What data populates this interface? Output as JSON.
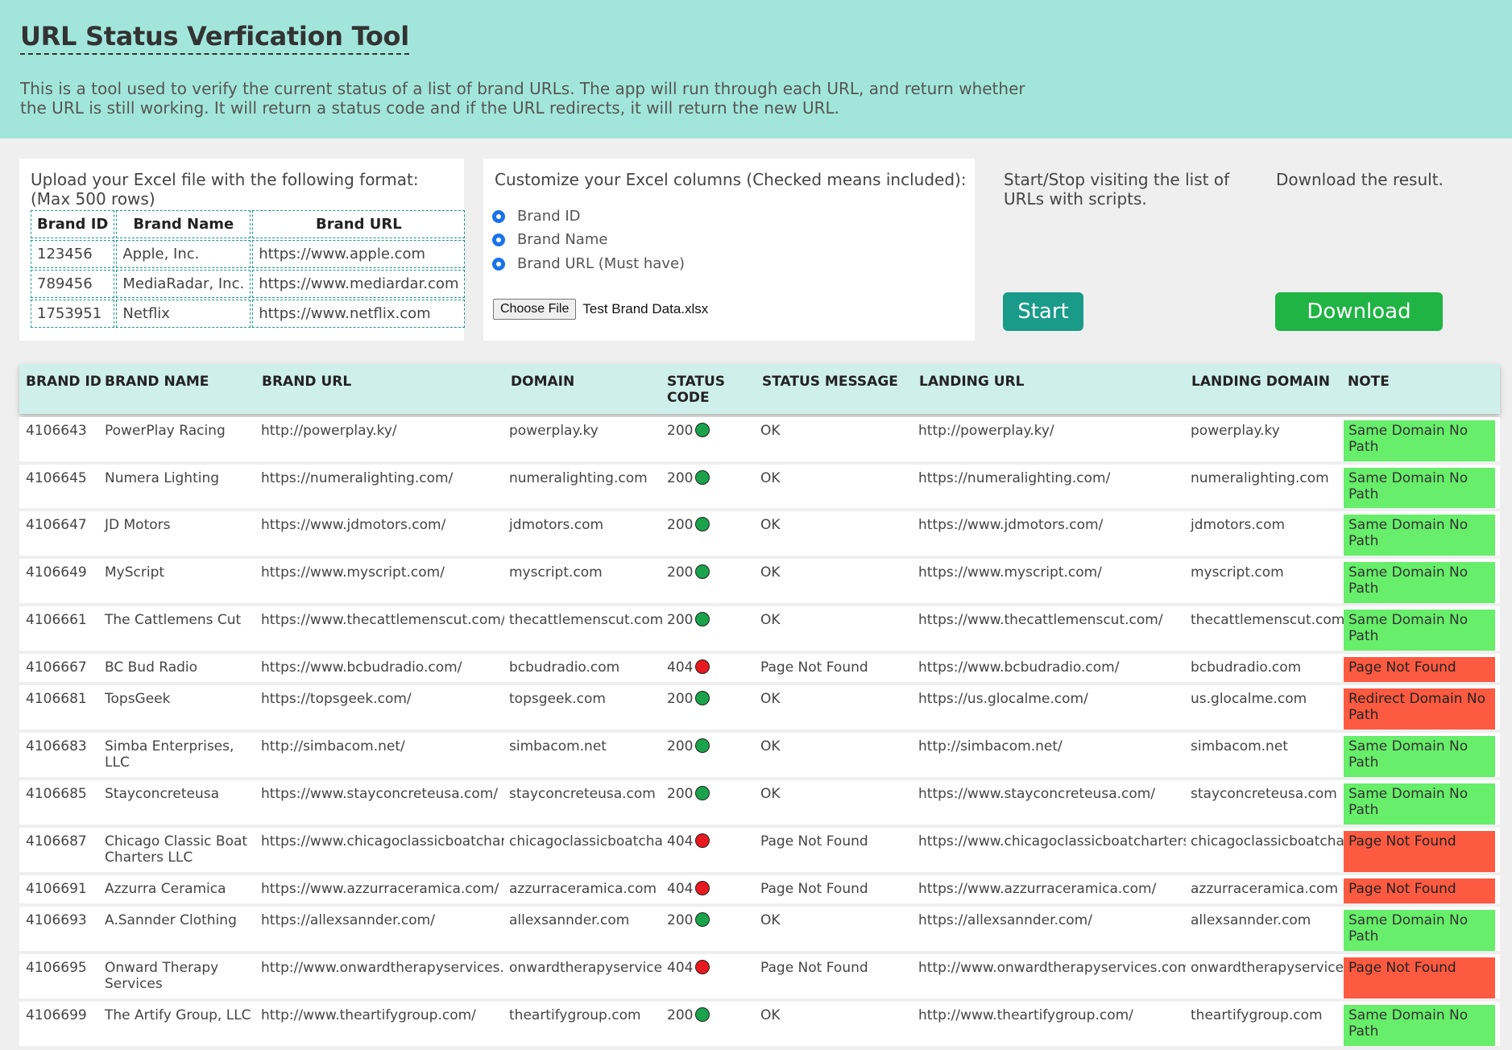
{
  "header": {
    "title": "URL Status Verfication Tool",
    "description": "This is a tool used to verify the current status of a list of brand URLs. The app will run through each URL, and return whether the URL is still working. It will return a status code and if the URL redirects, it will return the new URL."
  },
  "upload": {
    "instructions": "Upload your Excel file with the following format:",
    "max_rows": "(Max 500 rows)",
    "format_headers": [
      "Brand ID",
      "Brand Name",
      "Brand URL"
    ],
    "format_rows": [
      [
        "123456",
        "Apple, Inc.",
        "https://www.apple.com"
      ],
      [
        "789456",
        "MediaRadar, Inc.",
        "https://www.mediardar.com"
      ],
      [
        "1753951",
        "Netflix",
        "https://www.netflix.com"
      ]
    ]
  },
  "customize": {
    "label": "Customize your Excel columns (Checked means included):",
    "options": [
      "Brand ID",
      "Brand Name",
      "Brand URL (Must have)"
    ],
    "choose_file_label": "Choose File",
    "file_name": "Test Brand Data.xlsx"
  },
  "start_section": {
    "text": "Start/Stop visiting the list of URLs with scripts.",
    "button": "Start"
  },
  "download_section": {
    "text": "Download the result.",
    "button": "Download"
  },
  "results": {
    "headers": [
      "BRAND ID",
      "BRAND NAME",
      "BRAND URL",
      "DOMAIN",
      "STATUS CODE",
      "STATUS MESSAGE",
      "LANDING URL",
      "LANDING DOMAIN",
      "NOTE"
    ],
    "colors": {
      "ok": "#1aa34a",
      "error": "#e8191f",
      "note_ok": "#67ee6a",
      "note_error": "#fc5a41"
    },
    "rows": [
      {
        "id": "4106643",
        "name": "PowerPlay Racing",
        "url": "http://powerplay.ky/",
        "domain": "powerplay.ky",
        "code": "200",
        "msg": "OK",
        "landing": "http://powerplay.ky/",
        "ldomain": "powerplay.ky",
        "note": "Same Domain No Path"
      },
      {
        "id": "4106645",
        "name": "Numera Lighting",
        "url": "https://numeralighting.com/",
        "domain": "numeralighting.com",
        "code": "200",
        "msg": "OK",
        "landing": "https://numeralighting.com/",
        "ldomain": "numeralighting.com",
        "note": "Same Domain No Path"
      },
      {
        "id": "4106647",
        "name": "JD Motors",
        "url": "https://www.jdmotors.com/",
        "domain": "jdmotors.com",
        "code": "200",
        "msg": "OK",
        "landing": "https://www.jdmotors.com/",
        "ldomain": "jdmotors.com",
        "note": "Same Domain No Path"
      },
      {
        "id": "4106649",
        "name": "MyScript",
        "url": "https://www.myscript.com/",
        "domain": "myscript.com",
        "code": "200",
        "msg": "OK",
        "landing": "https://www.myscript.com/",
        "ldomain": "myscript.com",
        "note": "Same Domain No Path"
      },
      {
        "id": "4106661",
        "name": "The Cattlemens Cut",
        "url": "https://www.thecattlemenscut.com/",
        "domain": "thecattlemenscut.com",
        "code": "200",
        "msg": "OK",
        "landing": "https://www.thecattlemenscut.com/",
        "ldomain": "thecattlemenscut.com",
        "note": "Same Domain No Path"
      },
      {
        "id": "4106667",
        "name": "BC Bud Radio",
        "url": "https://www.bcbudradio.com/",
        "domain": "bcbudradio.com",
        "code": "404",
        "msg": "Page Not Found",
        "landing": "https://www.bcbudradio.com/",
        "ldomain": "bcbudradio.com",
        "note": "Page Not Found"
      },
      {
        "id": "4106681",
        "name": "TopsGeek",
        "url": "https://topsgeek.com/",
        "domain": "topsgeek.com",
        "code": "200",
        "msg": "OK",
        "landing": "https://us.glocalme.com/",
        "ldomain": "us.glocalme.com",
        "note": "Redirect Domain No Path"
      },
      {
        "id": "4106683",
        "name": "Simba Enterprises, LLC",
        "url": "http://simbacom.net/",
        "domain": "simbacom.net",
        "code": "200",
        "msg": "OK",
        "landing": "http://simbacom.net/",
        "ldomain": "simbacom.net",
        "note": "Same Domain No Path"
      },
      {
        "id": "4106685",
        "name": "Stayconcreteusa",
        "url": "https://www.stayconcreteusa.com/",
        "domain": "stayconcreteusa.com",
        "code": "200",
        "msg": "OK",
        "landing": "https://www.stayconcreteusa.com/",
        "ldomain": "stayconcreteusa.com",
        "note": "Same Domain No Path"
      },
      {
        "id": "4106687",
        "name": "Chicago Classic Boat Charters LLC",
        "url": "https://www.chicagoclassicboatcharters.com/",
        "domain": "chicagoclassicboatcharters.com",
        "code": "404",
        "msg": "Page Not Found",
        "landing": "https://www.chicagoclassicboatcharters.com/",
        "ldomain": "chicagoclassicboatcharters.com",
        "note": "Page Not Found"
      },
      {
        "id": "4106691",
        "name": "Azzurra Ceramica",
        "url": "https://www.azzurraceramica.com/",
        "domain": "azzurraceramica.com",
        "code": "404",
        "msg": "Page Not Found",
        "landing": "https://www.azzurraceramica.com/",
        "ldomain": "azzurraceramica.com",
        "note": "Page Not Found"
      },
      {
        "id": "4106693",
        "name": "A.Sannder Clothing",
        "url": "https://allexsannder.com/",
        "domain": "allexsannder.com",
        "code": "200",
        "msg": "OK",
        "landing": "https://allexsannder.com/",
        "ldomain": "allexsannder.com",
        "note": "Same Domain No Path"
      },
      {
        "id": "4106695",
        "name": "Onward Therapy Services",
        "url": "http://www.onwardtherapyservices.com/",
        "domain": "onwardtherapyservices.com",
        "code": "404",
        "msg": "Page Not Found",
        "landing": "http://www.onwardtherapyservices.com/",
        "ldomain": "onwardtherapyservices.com",
        "note": "Page Not Found"
      },
      {
        "id": "4106699",
        "name": "The Artify Group, LLC",
        "url": "http://www.theartifygroup.com/",
        "domain": "theartifygroup.com",
        "code": "200",
        "msg": "OK",
        "landing": "http://www.theartifygroup.com/",
        "ldomain": "theartifygroup.com",
        "note": "Same Domain No Path"
      }
    ]
  }
}
